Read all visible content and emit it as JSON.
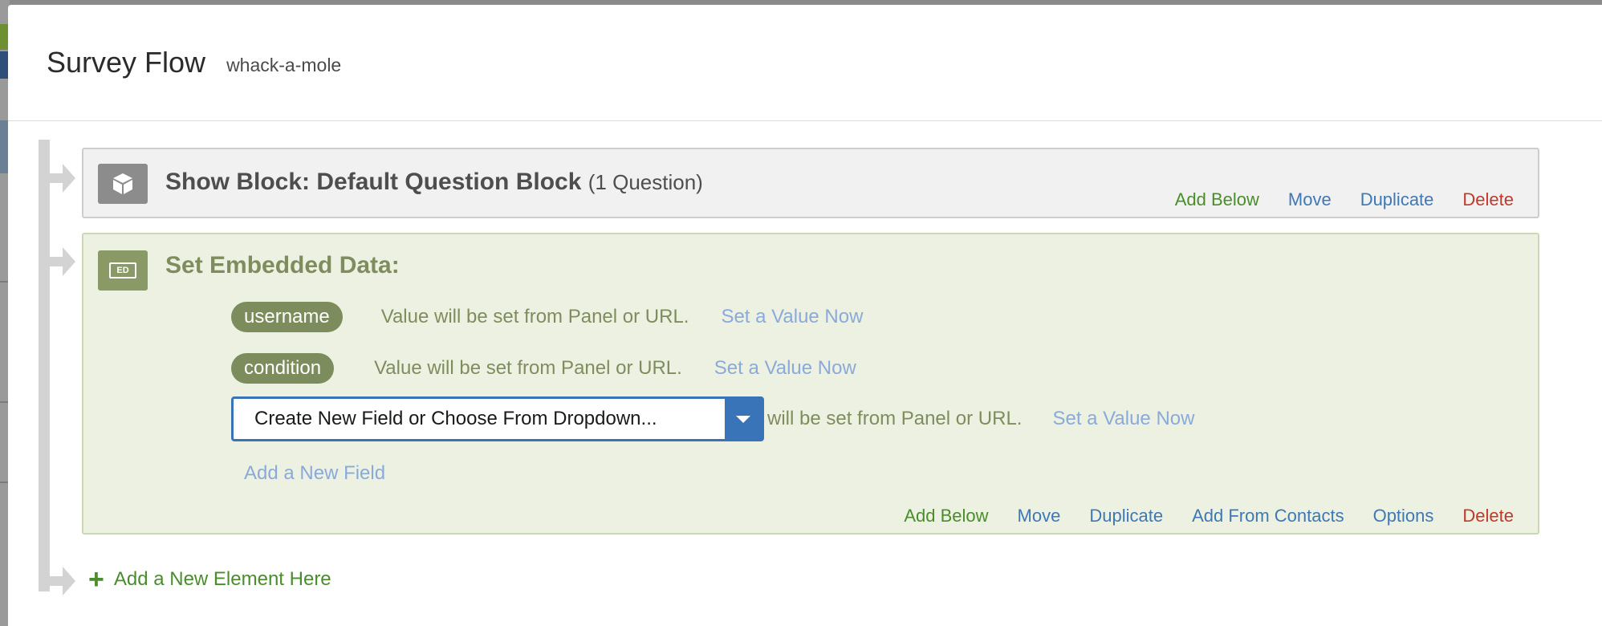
{
  "modal": {
    "title": "Survey Flow",
    "subtitle": "whack-a-mole"
  },
  "show_block": {
    "title": "Show Block: Default Question Block",
    "count": "(1 Question)",
    "icon": "cube-icon",
    "actions": {
      "add_below": "Add Below",
      "move": "Move",
      "duplicate": "Duplicate",
      "delete": "Delete"
    }
  },
  "embedded_block": {
    "title": "Set Embedded Data:",
    "icon_text": "ED",
    "fields": [
      {
        "name": "username",
        "note": "Value will be set from Panel or URL.",
        "link": "Set a Value Now"
      },
      {
        "name": "condition",
        "note": "Value will be set from Panel or URL.",
        "link": "Set a Value Now"
      }
    ],
    "new_field": {
      "placeholder": "Create New Field or Choose From Dropdown...",
      "note_tail": "e will be set from Panel or URL.",
      "link": "Set a Value Now"
    },
    "add_field": "Add a New Field",
    "actions": {
      "add_below": "Add Below",
      "move": "Move",
      "duplicate": "Duplicate",
      "add_from_contacts": "Add From Contacts",
      "options": "Options",
      "delete": "Delete"
    }
  },
  "add_element": {
    "icon": "+",
    "label": "Add a New Element Here"
  },
  "colors": {
    "green_action": "#4a8d2c",
    "blue_action": "#3e78b5",
    "red_action": "#c0392b",
    "embed_bg": "#edf1e2",
    "pill_bg": "#7c8c5c"
  }
}
